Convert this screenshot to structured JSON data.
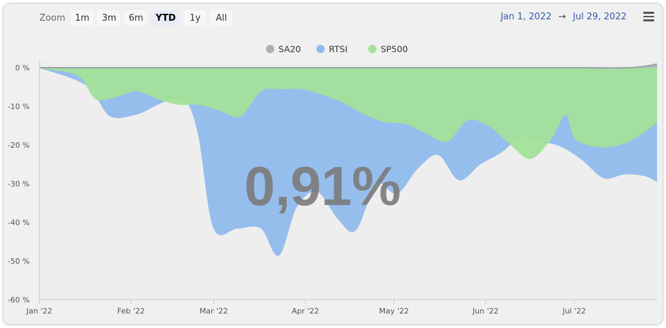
{
  "toolbar": {
    "zoom_label": "Zoom",
    "zoom_buttons": [
      {
        "label": "1m",
        "active": false
      },
      {
        "label": "3m",
        "active": false
      },
      {
        "label": "6m",
        "active": false
      },
      {
        "label": "YTD",
        "active": true
      },
      {
        "label": "1y",
        "active": false
      },
      {
        "label": "All",
        "active": false
      }
    ],
    "date_from": "Jan 1, 2022",
    "date_arrow": "→",
    "date_to": "Jul 29, 2022",
    "menu_icon": "hamburger-menu-icon"
  },
  "chart_data": {
    "type": "area",
    "title": "",
    "xlabel": "",
    "ylabel": "",
    "big_value": "0,91%",
    "ylim": [
      -60,
      0
    ],
    "xlim": [
      "2022-01-01",
      "2022-07-29"
    ],
    "y_ticks": [
      "0 %",
      "-10 %",
      "-20 %",
      "-30 %",
      "-40 %",
      "-50 %",
      "-60 %"
    ],
    "x_ticks": [
      {
        "label": "Jan '22",
        "date": "2022-01-01"
      },
      {
        "label": "Feb '22",
        "date": "2022-02-01"
      },
      {
        "label": "Mar '22",
        "date": "2022-03-01"
      },
      {
        "label": "Apr '22",
        "date": "2022-04-01"
      },
      {
        "label": "May '22",
        "date": "2022-05-01"
      },
      {
        "label": "Jun '22",
        "date": "2022-06-01"
      },
      {
        "label": "Jul '22",
        "date": "2022-07-01"
      }
    ],
    "grid": false,
    "legend_position": "top-center",
    "series": [
      {
        "name": "SA20",
        "color": "#aab1b5",
        "x": [
          "2022-01-01",
          "2022-02-01",
          "2022-03-01",
          "2022-04-01",
          "2022-05-01",
          "2022-06-01",
          "2022-07-01",
          "2022-07-20",
          "2022-07-29"
        ],
        "values": [
          0,
          0,
          0,
          0,
          0,
          0,
          0,
          0,
          0.91
        ]
      },
      {
        "name": "RTSI",
        "color": "#90baec",
        "x": [
          "2022-01-01",
          "2022-01-13",
          "2022-01-19",
          "2022-01-25",
          "2022-02-03",
          "2022-02-10",
          "2022-02-15",
          "2022-02-20",
          "2022-02-24",
          "2022-03-01",
          "2022-03-09",
          "2022-03-17",
          "2022-03-23",
          "2022-03-29",
          "2022-04-05",
          "2022-04-12",
          "2022-04-18",
          "2022-04-25",
          "2022-05-02",
          "2022-05-09",
          "2022-05-16",
          "2022-05-23",
          "2022-05-30",
          "2022-06-06",
          "2022-06-13",
          "2022-06-20",
          "2022-06-27",
          "2022-07-04",
          "2022-07-11",
          "2022-07-18",
          "2022-07-25",
          "2022-07-29"
        ],
        "values": [
          0,
          -3,
          -6,
          -12.5,
          -12,
          -9.5,
          -8,
          -9,
          -18,
          -41.5,
          -41.5,
          -41.5,
          -48.5,
          -36,
          -32,
          -39,
          -42,
          -30,
          -32.5,
          -26,
          -22.5,
          -29,
          -25,
          -22,
          -18,
          -19,
          -20.5,
          -24,
          -28.5,
          -27.5,
          -28,
          -29.5
        ]
      },
      {
        "name": "SP500",
        "color": "#a3e09a",
        "x": [
          "2022-01-01",
          "2022-01-14",
          "2022-01-20",
          "2022-01-27",
          "2022-02-03",
          "2022-02-10",
          "2022-02-17",
          "2022-02-24",
          "2022-03-03",
          "2022-03-10",
          "2022-03-17",
          "2022-03-24",
          "2022-03-31",
          "2022-04-07",
          "2022-04-14",
          "2022-04-21",
          "2022-04-28",
          "2022-05-05",
          "2022-05-12",
          "2022-05-19",
          "2022-05-26",
          "2022-06-02",
          "2022-06-09",
          "2022-06-16",
          "2022-06-23",
          "2022-06-28",
          "2022-07-01",
          "2022-07-06",
          "2022-07-12",
          "2022-07-18",
          "2022-07-24",
          "2022-07-29"
        ],
        "values": [
          0,
          -2,
          -8,
          -7.5,
          -6,
          -8,
          -9.5,
          -9.5,
          -11,
          -12.5,
          -6,
          -5.5,
          -5.5,
          -7,
          -9,
          -12,
          -14,
          -14.5,
          -17,
          -19,
          -13.5,
          -15,
          -19.5,
          -23.5,
          -18.5,
          -12,
          -18,
          -20,
          -20.5,
          -19.5,
          -17,
          -14
        ]
      }
    ]
  }
}
